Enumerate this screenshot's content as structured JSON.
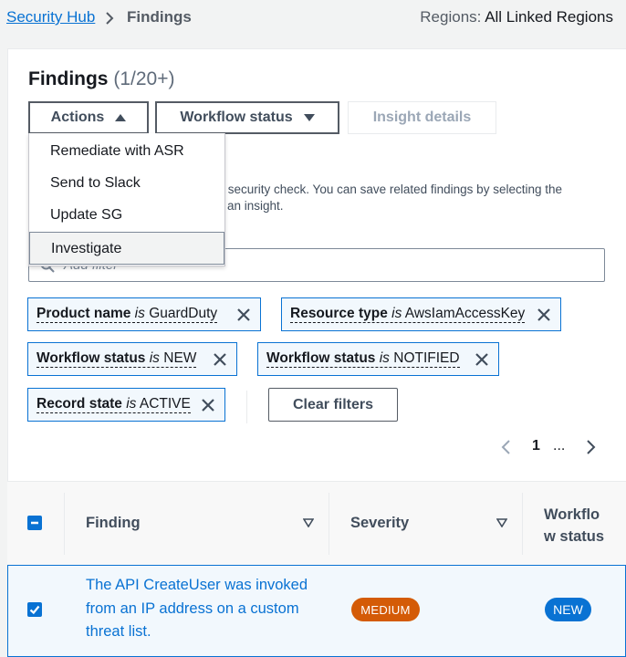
{
  "breadcrumb": {
    "root": "Security Hub",
    "current": "Findings"
  },
  "regions": {
    "label": "Regions:",
    "value": "All Linked Regions"
  },
  "page": {
    "title": "Findings",
    "count": "(1/20+)"
  },
  "toolbar": {
    "actions_label": "Actions",
    "workflow_label": "Workflow status",
    "insight_label": "Insight details"
  },
  "actions_menu": {
    "items": [
      "Remediate with ASR",
      "Send to Slack",
      "Update SG",
      "Investigate"
    ]
  },
  "description": {
    "line1": "ed security check. You can save related findings by selecting the",
    "line2": "an insight."
  },
  "filter": {
    "placeholder": "Add filter"
  },
  "filter_tokens": [
    {
      "key": "Product name",
      "op": "is",
      "value": "GuardDuty"
    },
    {
      "key": "Resource type",
      "op": "is",
      "value": "AwsIamAccessKey"
    },
    {
      "key": "Workflow status",
      "op": "is",
      "value": "NEW"
    },
    {
      "key": "Workflow status",
      "op": "is",
      "value": "NOTIFIED"
    },
    {
      "key": "Record state",
      "op": "is",
      "value": "ACTIVE"
    }
  ],
  "clear_filters_label": "Clear filters",
  "pagination": {
    "current": "1",
    "ellipsis": "..."
  },
  "table": {
    "columns": [
      "Finding",
      "Severity",
      "Workflo",
      "w status"
    ],
    "rows": [
      {
        "finding": "The API CreateUser was invoked from an IP address on a custom threat list.",
        "severity": "MEDIUM",
        "workflow_status": "NEW"
      }
    ]
  },
  "colors": {
    "link": "#0972d3",
    "severity_medium": "#d45b07",
    "status_new": "#0972d3"
  }
}
